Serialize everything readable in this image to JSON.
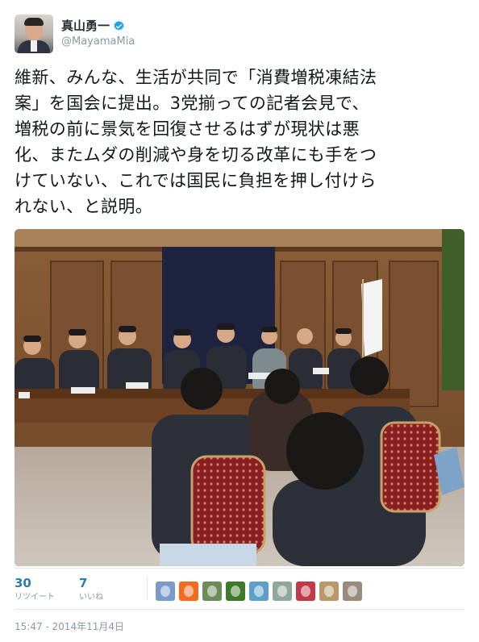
{
  "user": {
    "display_name": "真山勇一",
    "handle": "@MayamaMia",
    "verified": true
  },
  "tweet": {
    "text": "維新、みんな、生活が共同で「消費増税凍結法\n案」を国会に提出。3党揃っての記者会見で、\n増税の前に景気を回復させるはずが現状は悪\n化、またムダの削減や身を切る改革にも手をつ\nけていない、これでは国民に負担を押し付けら\nれない、と説明。",
    "photo": "press-conference-photo"
  },
  "stats": {
    "retweets": {
      "count": "30",
      "label": "リツイート"
    },
    "likes": {
      "count": "7",
      "label": "いいね"
    }
  },
  "likers": [
    {
      "name": "liker-avatar-1",
      "color": "#7a9bc9"
    },
    {
      "name": "liker-avatar-2",
      "color": "#f26b21"
    },
    {
      "name": "liker-avatar-3",
      "color": "#6c8a5a"
    },
    {
      "name": "liker-avatar-4",
      "color": "#3d7a2c"
    },
    {
      "name": "liker-avatar-5",
      "color": "#5aa0c8"
    },
    {
      "name": "liker-avatar-6",
      "color": "#8fa89a"
    },
    {
      "name": "liker-avatar-7",
      "color": "#c23a4a"
    },
    {
      "name": "liker-avatar-8",
      "color": "#b89a6a"
    },
    {
      "name": "liker-avatar-9",
      "color": "#9a8c7c"
    }
  ],
  "timestamp": "15:47 - 2014年11月4日",
  "colors": {
    "link": "#2a7cb8",
    "verified": "#1da1f2",
    "muted": "#8899a6",
    "text": "#14171a"
  }
}
